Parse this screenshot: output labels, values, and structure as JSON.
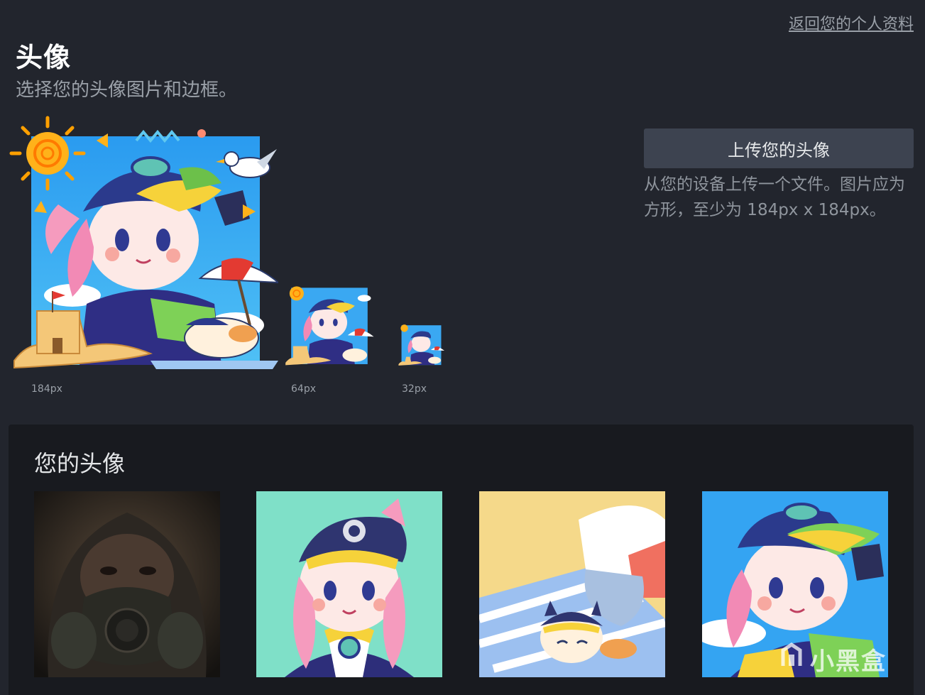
{
  "header": {
    "back_link": "返回您的个人资料",
    "title": "头像",
    "subtitle": "选择您的头像图片和边框。"
  },
  "preview": {
    "sizes": [
      {
        "label": "184px"
      },
      {
        "label": "64px"
      },
      {
        "label": "32px"
      }
    ]
  },
  "upload": {
    "button_label": "上传您的头像",
    "hint": "从您的设备上传一个文件。图片应为方形，至少为 184px x 184px。"
  },
  "your_avatars": {
    "title": "您的头像",
    "items": [
      {
        "name": "gas-mask-avatar"
      },
      {
        "name": "steam-cap-girl-avatar"
      },
      {
        "name": "beach-cat-avatar"
      },
      {
        "name": "beach-girl-avatar"
      }
    ]
  },
  "watermark": {
    "text": "小黑盒"
  },
  "colors": {
    "background": "#22252d",
    "panel": "#181a1f",
    "button": "#3d4350",
    "muted_text": "#9aa0a8"
  }
}
